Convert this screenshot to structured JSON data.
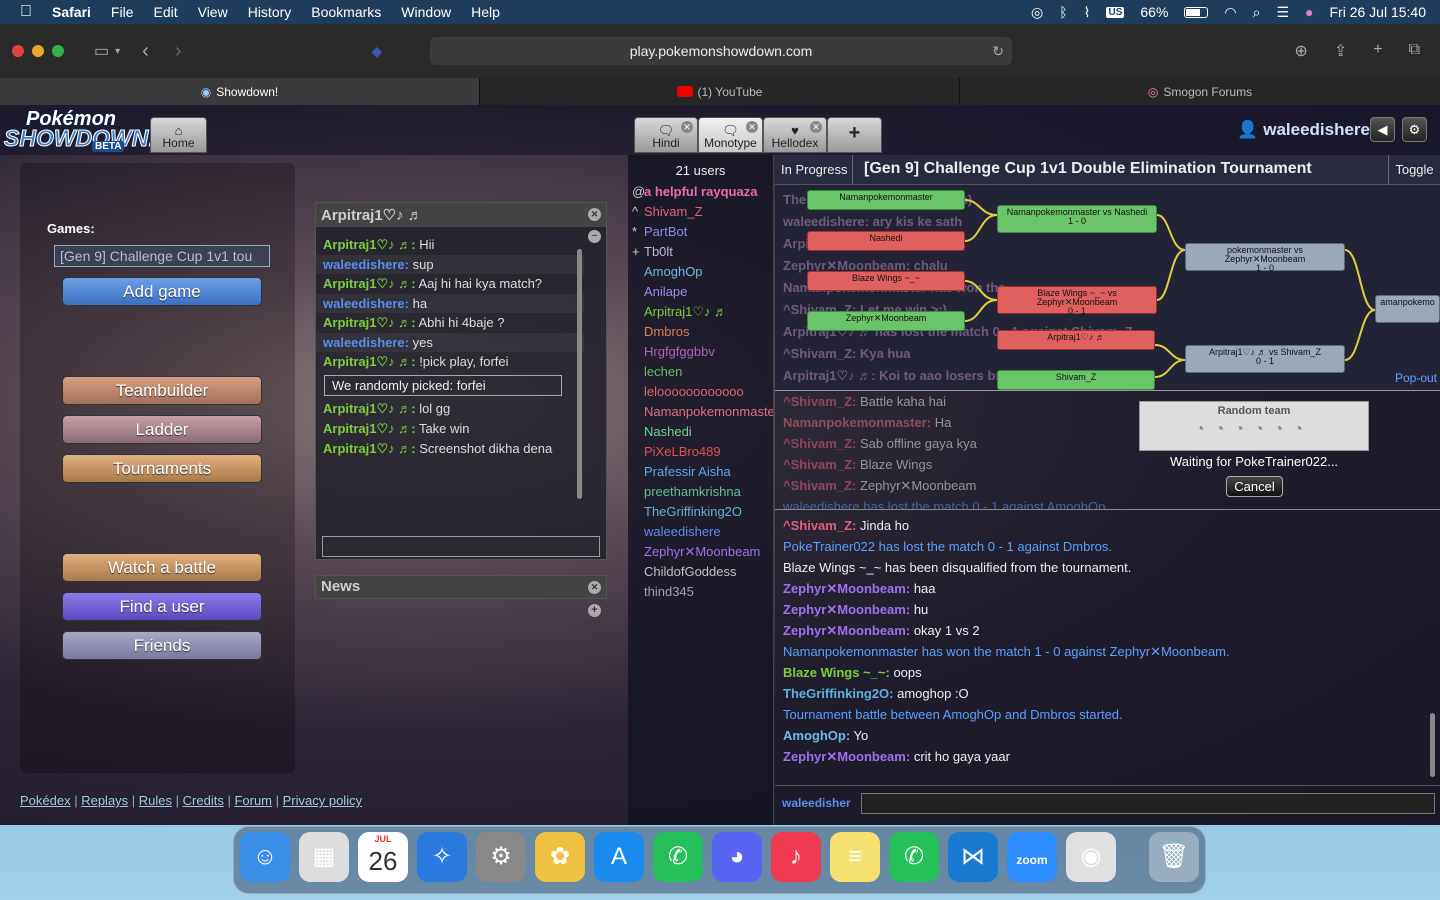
{
  "menubar": {
    "apple": "",
    "app": "Safari",
    "items": [
      "File",
      "Edit",
      "View",
      "History",
      "Bookmarks",
      "Window",
      "Help"
    ],
    "battery": "66%",
    "datetime": "Fri 26 Jul  15:40"
  },
  "browser": {
    "url": "play.pokemonshowdown.com",
    "tabs": [
      {
        "label": "Showdown!",
        "active": true
      },
      {
        "label": "(1) YouTube",
        "active": false
      },
      {
        "label": "Smogon Forums",
        "active": false
      }
    ]
  },
  "header": {
    "logo_top": "Pokémon",
    "logo_main": "SHOWDOWN!",
    "logo_badge": "BETA",
    "home_tab": "Home",
    "room_tabs": [
      "Hindi",
      "Monotype",
      "Hellodex"
    ],
    "add_tab": "+",
    "username": "waleedishere"
  },
  "mainmenu": {
    "games_label": "Games:",
    "format_value": "[Gen 9] Challenge Cup 1v1 tou",
    "add_game": "Add game",
    "buttons": [
      "Teambuilder",
      "Ladder",
      "Tournaments"
    ],
    "buttons2": [
      "Watch a battle",
      "Find a user",
      "Friends"
    ],
    "footer": [
      "Pokédex",
      "Replays",
      "Rules",
      "Credits",
      "Forum",
      "Privacy policy"
    ]
  },
  "pm": {
    "title": "Arpitraj1♡♪ ♬",
    "messages": [
      {
        "user": "Arpitraj1♡♪ ♬:",
        "text": "Hii",
        "who": "ar"
      },
      {
        "user": "waleedishere:",
        "text": "sup",
        "who": "wa"
      },
      {
        "user": "Arpitraj1♡♪ ♬:",
        "text": "Aaj hi hai kya match?",
        "who": "ar"
      },
      {
        "user": "waleedishere:",
        "text": "ha",
        "who": "wa"
      },
      {
        "user": "Arpitraj1♡♪ ♬:",
        "text": "Abhi hi 4baje ?",
        "who": "ar"
      },
      {
        "user": "waleedishere:",
        "text": "yes",
        "who": "wa"
      },
      {
        "user": "Arpitraj1♡♪ ♬:",
        "text": "!pick play, forfei",
        "who": "ar"
      }
    ],
    "pick_box": "We randomly picked:  forfei",
    "messages2": [
      {
        "user": "Arpitraj1♡♪ ♬:",
        "text": "lol gg"
      },
      {
        "user": "Arpitraj1♡♪ ♬:",
        "text": "Take win"
      },
      {
        "user": "Arpitraj1♡♪ ♬:",
        "text": "Screenshot dikha dena"
      }
    ]
  },
  "news": {
    "title": "News"
  },
  "userlist": {
    "count": "21 users",
    "users": [
      {
        "rank": "@",
        "name": "a helpful rayquaza",
        "color": "#e86ab0",
        "bold": true
      },
      {
        "rank": "^",
        "name": "Shivam_Z",
        "color": "#e0607a"
      },
      {
        "rank": "*",
        "name": "PartBot",
        "color": "#8a8af0"
      },
      {
        "rank": "+",
        "name": "Tb0lt",
        "color": "#b8b8d8"
      },
      {
        "rank": "",
        "name": "AmoghOp",
        "color": "#6ab8f0"
      },
      {
        "rank": "",
        "name": "Anilape",
        "color": "#a08af0"
      },
      {
        "rank": "",
        "name": "Arpitraj1♡♪ ♬",
        "color": "#7ccf3c"
      },
      {
        "rank": "",
        "name": "Dmbros",
        "color": "#e08050"
      },
      {
        "rank": "",
        "name": "Hrgfgfggbbv",
        "color": "#b060c0"
      },
      {
        "rank": "",
        "name": "lechen",
        "color": "#60c060"
      },
      {
        "rank": "",
        "name": "leloooooooooooo",
        "color": "#e06070"
      },
      {
        "rank": "",
        "name": "Namanpokemonmaster",
        "color": "#e07080"
      },
      {
        "rank": "",
        "name": "Nashedi",
        "color": "#6ad090"
      },
      {
        "rank": "",
        "name": "PiXeLBro489",
        "color": "#e05050"
      },
      {
        "rank": "",
        "name": "Prafessir Aisha",
        "color": "#5aa8f0"
      },
      {
        "rank": "",
        "name": "preethamkrishna",
        "color": "#60c090"
      },
      {
        "rank": "",
        "name": "TheGriffinking2O",
        "color": "#60b0e0"
      },
      {
        "rank": "",
        "name": "waleedishere",
        "color": "#5a8ff0"
      },
      {
        "rank": "",
        "name": "Zephyr✕Moonbeam",
        "color": "#a070f0"
      },
      {
        "rank": "",
        "name": "ChildofGoddess",
        "color": "#c0c0c0"
      },
      {
        "rank": "",
        "name": "thind345",
        "color": "#a0a0a0"
      }
    ]
  },
  "tournament": {
    "status": "In Progress",
    "title": "[Gen 9] Challenge Cup 1v1 Double Elimination Tournament",
    "toggle": "Toggle",
    "popout": "Pop-out",
    "nodes": {
      "n1": "Namanpokemonmaster",
      "n2": "Nashedi",
      "n3": "Namanpokemonmaster vs Nashedi",
      "n3s": "1 - 0",
      "n4": "Blaze Wings ~_~",
      "n5": "Zephyr✕Moonbeam",
      "n6": "Blaze Wings ~_~ vs Zephyr✕Moonbeam",
      "n6s": "0 - 1",
      "n7": "pokemonmaster vs Zephyr✕Moonbeam",
      "n7s": "1 - 0",
      "n8": "amanpokemo",
      "n9": "Arpitraj1♡♪ ♬",
      "n10": "Shivam_Z",
      "n11": "Arpitraj1♡♪ ♬ vs Shivam_Z",
      "n11s": "0 - 1"
    },
    "behind_msgs": [
      "The tou... started!! (10 players)",
      "waleedishere: ary kis ke sath",
      "Arpitraj1♡♪ ♬: hi kya ?",
      "Zephyr✕Moonbeam: chalu",
      "Namanpokemonmaster has won the",
      "^Shivam_Z: Let me win >:)",
      "Arpitraj1♡♪ ♬ has lost the match 0 - 1 against Shivam_Z",
      "^Shivam_Z: Kya hua",
      "Arpitraj1♡♪ ♬: Koi to aao losers bracket m"
    ]
  },
  "chat": {
    "faded": [
      {
        "u": "^Shivam_Z:",
        "t": "Battle kaha hai",
        "c": "#e0607a"
      },
      {
        "u": "Namanpokemonmaster:",
        "t": "Ha",
        "c": "#e07080"
      },
      {
        "u": "^Shivam_Z:",
        "t": "Sab offline gaya kya",
        "c": "#e0607a"
      },
      {
        "u": "^Shivam_Z:",
        "t": "Blaze Wings",
        "c": "#e0607a"
      },
      {
        "u": "^Shivam_Z:",
        "t": "Zephyr✕Moonbeam",
        "c": "#e0607a"
      },
      {
        "u": "",
        "t": "waleedishere has lost the match 0 - 1 against AmoghOp.",
        "c": "#5ba0ff"
      }
    ],
    "messages": [
      {
        "u": "^Shivam_Z:",
        "t": "Jinda ho",
        "c": "#e0607a"
      },
      {
        "u": "",
        "t": "PokeTrainer022 has lost the match 0 - 1 against Dmbros.",
        "c": "sys"
      },
      {
        "u": "",
        "t": "Blaze Wings ~_~ has been disqualified from the tournament.",
        "c": "plain"
      },
      {
        "u": "Zephyr✕Moonbeam:",
        "t": "haa",
        "c": "#a070f0"
      },
      {
        "u": "Zephyr✕Moonbeam:",
        "t": "hu",
        "c": "#a070f0"
      },
      {
        "u": "Zephyr✕Moonbeam:",
        "t": "okay 1 vs 2",
        "c": "#a070f0"
      },
      {
        "u": "",
        "t": "Namanpokemonmaster has won the match 1 - 0 against Zephyr✕Moonbeam.",
        "c": "sys"
      },
      {
        "u": "Blaze Wings ~_~:",
        "t": "oops",
        "c": "#7ccf3c"
      },
      {
        "u": "TheGriffinking2O:",
        "t": "amoghop :O",
        "c": "#60b0e0"
      },
      {
        "u": "",
        "t": "Tournament battle between AmoghOp and Dmbros started.",
        "c": "sys"
      },
      {
        "u": "AmoghOp:",
        "t": "Yo",
        "c": "#6ab8f0"
      },
      {
        "u": "Zephyr✕Moonbeam:",
        "t": "crit ho gaya yaar",
        "c": "#a070f0"
      }
    ],
    "input_user": "waleedisher"
  },
  "waiting": {
    "title": "Random team",
    "text": "Waiting for PokeTrainer022...",
    "cancel": "Cancel"
  },
  "dock": {
    "date_month": "JUL",
    "date_day": "26",
    "zoom": "zoom"
  }
}
